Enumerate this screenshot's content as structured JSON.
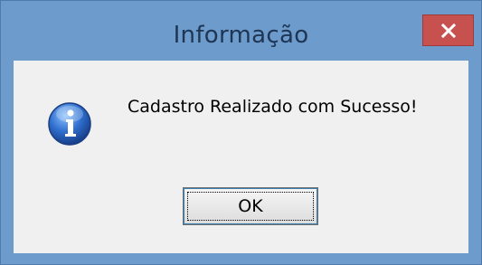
{
  "window": {
    "title": "Informação",
    "close_icon": "close-icon"
  },
  "dialog": {
    "icon": "info-icon",
    "message": "Cadastro Realizado com Sucesso!",
    "ok_label": "OK"
  },
  "colors": {
    "frame": "#6d9bcb",
    "close_button": "#c7514f",
    "client_background": "#f0f0f0",
    "info_icon": "#2f6fce"
  }
}
